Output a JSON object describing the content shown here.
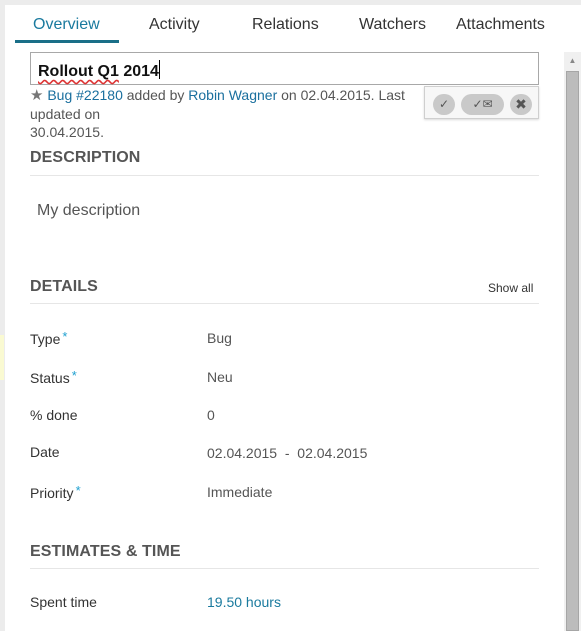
{
  "tabs": [
    {
      "label": "Overview",
      "active": true
    },
    {
      "label": "Activity",
      "active": false
    },
    {
      "label": "Relations",
      "active": false
    },
    {
      "label": "Watchers",
      "active": false
    },
    {
      "label": "Attachments",
      "active": false
    }
  ],
  "title_input": {
    "value_part1": "Rollout Q1",
    "value_part2": " 2014"
  },
  "meta": {
    "star_icon": "star-icon",
    "work_package_link": "Bug #22180",
    "added_by_text": " added by ",
    "author_link": "Robin Wagner",
    "created_text": " on 02.04.2015. Last updated on",
    "updated_date": "30.04.2015."
  },
  "edit_actions": {
    "save_icon": "✓",
    "save_notify_icon": "✓✉",
    "cancel_icon": "✖"
  },
  "description": {
    "heading": "DESCRIPTION",
    "text": "My description"
  },
  "details": {
    "heading": "DETAILS",
    "show_all_label": "Show all",
    "rows": [
      {
        "label": "Type",
        "required": "*",
        "value": "Bug"
      },
      {
        "label": "Status",
        "required": "*",
        "value": "Neu"
      },
      {
        "label": "% done",
        "required": "",
        "value": "0"
      },
      {
        "label": "Date",
        "required": "",
        "value": "02.04.2015  -  02.04.2015"
      },
      {
        "label": "Priority",
        "required": "*",
        "value": "Immediate"
      }
    ]
  },
  "estimates": {
    "heading": "ESTIMATES & TIME",
    "rows": [
      {
        "label": "Spent time",
        "value": "19.50 hours"
      }
    ]
  },
  "colors": {
    "accent": "#1a7a9e",
    "required_marker": "#1fa0d0",
    "tab_underline": "#1a6f88"
  }
}
